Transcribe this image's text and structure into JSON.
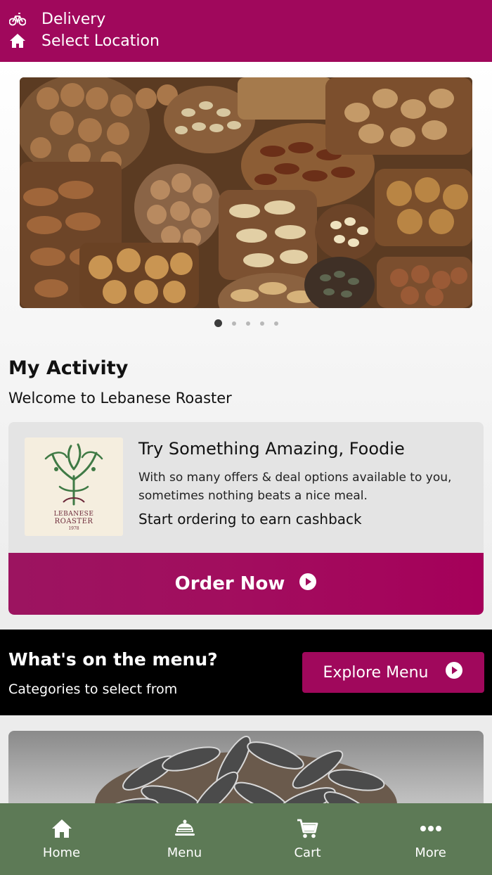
{
  "header": {
    "mode_label": "Delivery",
    "location_label": "Select Location"
  },
  "carousel": {
    "slides": 5,
    "active_index": 0
  },
  "activity": {
    "title": "My Activity",
    "subtitle": "Welcome to Lebanese Roaster"
  },
  "offer": {
    "logo_line1": "LEBANESE",
    "logo_line2": "ROASTER",
    "logo_line3": "1978",
    "title": "Try Something Amazing, Foodie",
    "description": "With so many offers & deal options available to you, sometimes nothing beats a nice meal.",
    "cta_text": "Start ordering to earn cashback",
    "button_label": "Order Now"
  },
  "menu_section": {
    "title": "What's on the menu?",
    "subtitle": "Categories to select from",
    "button_label": "Explore Menu"
  },
  "bottom_nav": {
    "items": [
      {
        "label": "Home",
        "icon": "home-icon"
      },
      {
        "label": "Menu",
        "icon": "menu-icon"
      },
      {
        "label": "Cart",
        "icon": "cart-icon"
      },
      {
        "label": "More",
        "icon": "more-icon"
      }
    ]
  },
  "colors": {
    "brand": "#a0085c",
    "nav_bg": "#5d7a56",
    "menu_strip_bg": "#000000"
  }
}
